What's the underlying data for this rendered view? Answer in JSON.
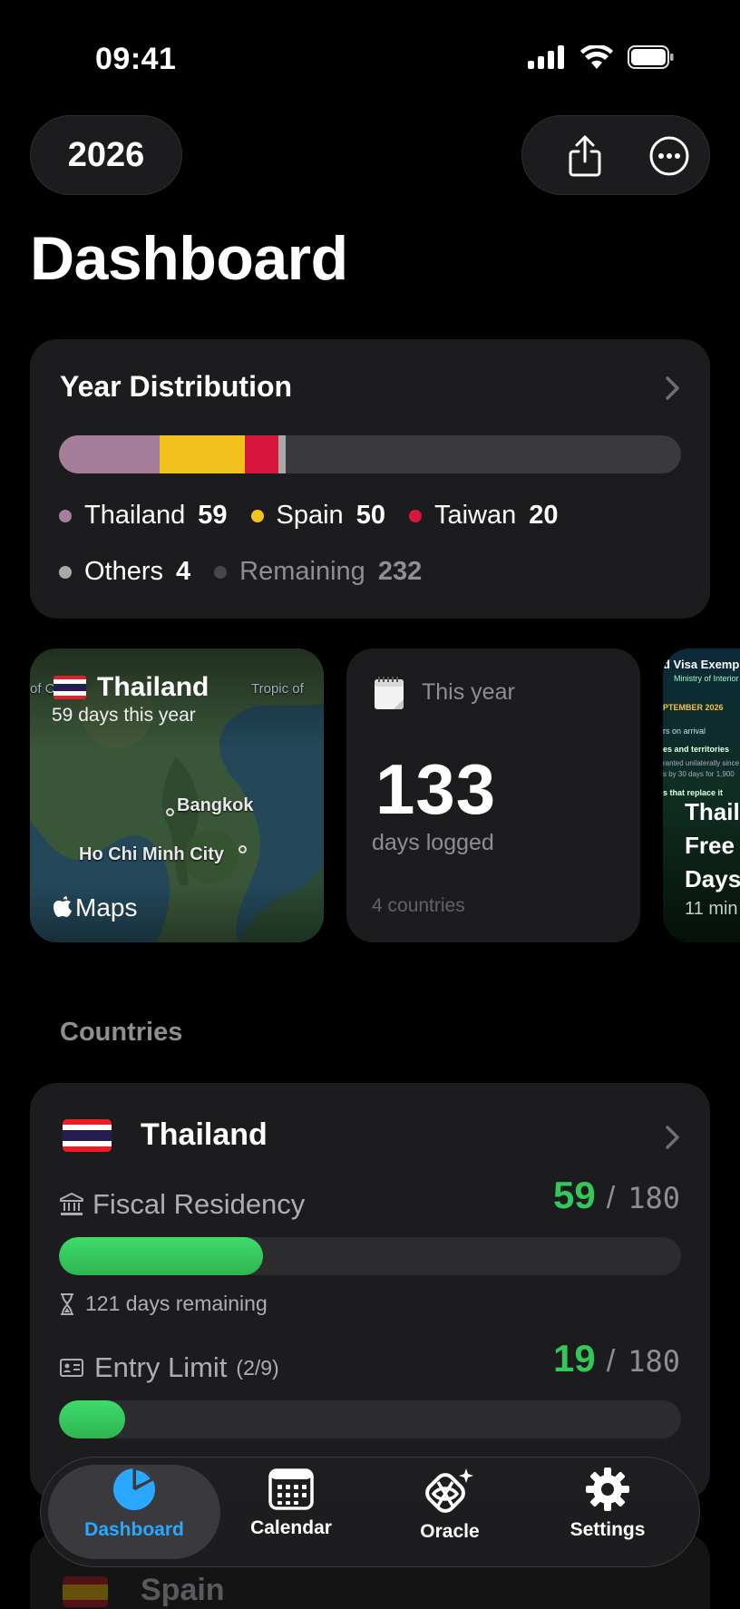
{
  "status_bar": {
    "time": "09:41"
  },
  "header": {
    "year": "2026",
    "title": "Dashboard",
    "share_icon": "share-icon",
    "more_icon": "more-icon"
  },
  "year_distribution": {
    "title": "Year Distribution",
    "segments": [
      {
        "country": "Thailand",
        "days": 59,
        "color": "#a57e99"
      },
      {
        "country": "Spain",
        "days": 50,
        "color": "#f2c31e"
      },
      {
        "country": "Taiwan",
        "days": 20,
        "color": "#d8163b"
      },
      {
        "country": "Others",
        "days": 4,
        "color": "#a8a8a8"
      },
      {
        "country": "Remaining",
        "days": 232,
        "color": "#3a3a3c"
      }
    ],
    "legend": [
      {
        "label": "Thailand",
        "value": "59",
        "color": "#a57e99"
      },
      {
        "label": "Spain",
        "value": "50",
        "color": "#f2c31e"
      },
      {
        "label": "Taiwan",
        "value": "20",
        "color": "#d8163b"
      },
      {
        "label": "Others",
        "value": "4",
        "color": "#a8a8a8"
      },
      {
        "label": "Remaining",
        "value": "232",
        "color": "#3a3a3c"
      }
    ]
  },
  "carousel": {
    "map_tile": {
      "flag": "thailand-flag",
      "country": "Thailand",
      "subtitle": "59 days this year",
      "city1": "Bangkok",
      "city2": "Ho Chi Minh City",
      "map_label_left": "of Canc",
      "map_label_right": "Tropic of",
      "brand": "Maps"
    },
    "stat_tile": {
      "icon": "calendar-page-icon",
      "label": "This year",
      "value": "133",
      "unit": "days logged",
      "footnote": "4 countries"
    },
    "visa_tile": {
      "thumb_title": "d Visa Exemp",
      "thumb_sub": "Ministry of Interior",
      "thumb_date": "PTEMBER 2026",
      "thumb_line1": "rs on arrival",
      "thumb_line2": "es and territories",
      "thumb_line3": "ranted unilaterally since",
      "thumb_line4": "s by 30 days for 1,900",
      "thumb_line5": "s that replace it",
      "headline_1": "Thail",
      "headline_2": "Free",
      "headline_3": "Days",
      "meta": "11 min"
    }
  },
  "countries": {
    "section_title": "Countries",
    "items": [
      {
        "name": "Thailand",
        "flag": "thailand-flag",
        "fiscal_label": "Fiscal Residency",
        "fiscal_value": "59",
        "fiscal_limit": "180",
        "fiscal_progress": 0.328,
        "remaining_text": "121 days remaining",
        "entry_label": "Entry Limit",
        "entry_count": "(2/9)",
        "entry_value": "19",
        "entry_limit": "180",
        "entry_progress": 0.106
      },
      {
        "name": "Spain",
        "flag": "spain-flag"
      }
    ]
  },
  "tab_bar": {
    "tabs": [
      {
        "label": "Dashboard",
        "icon": "pie-chart-icon",
        "active": true
      },
      {
        "label": "Calendar",
        "icon": "calendar-icon",
        "active": false
      },
      {
        "label": "Oracle",
        "icon": "oracle-sparkle-icon",
        "active": false
      },
      {
        "label": "Settings",
        "icon": "gear-icon",
        "active": false
      }
    ]
  },
  "colors": {
    "accent_blue": "#2aa8ff",
    "progress_green": "#34c759",
    "card_bg": "#1c1c1e"
  }
}
